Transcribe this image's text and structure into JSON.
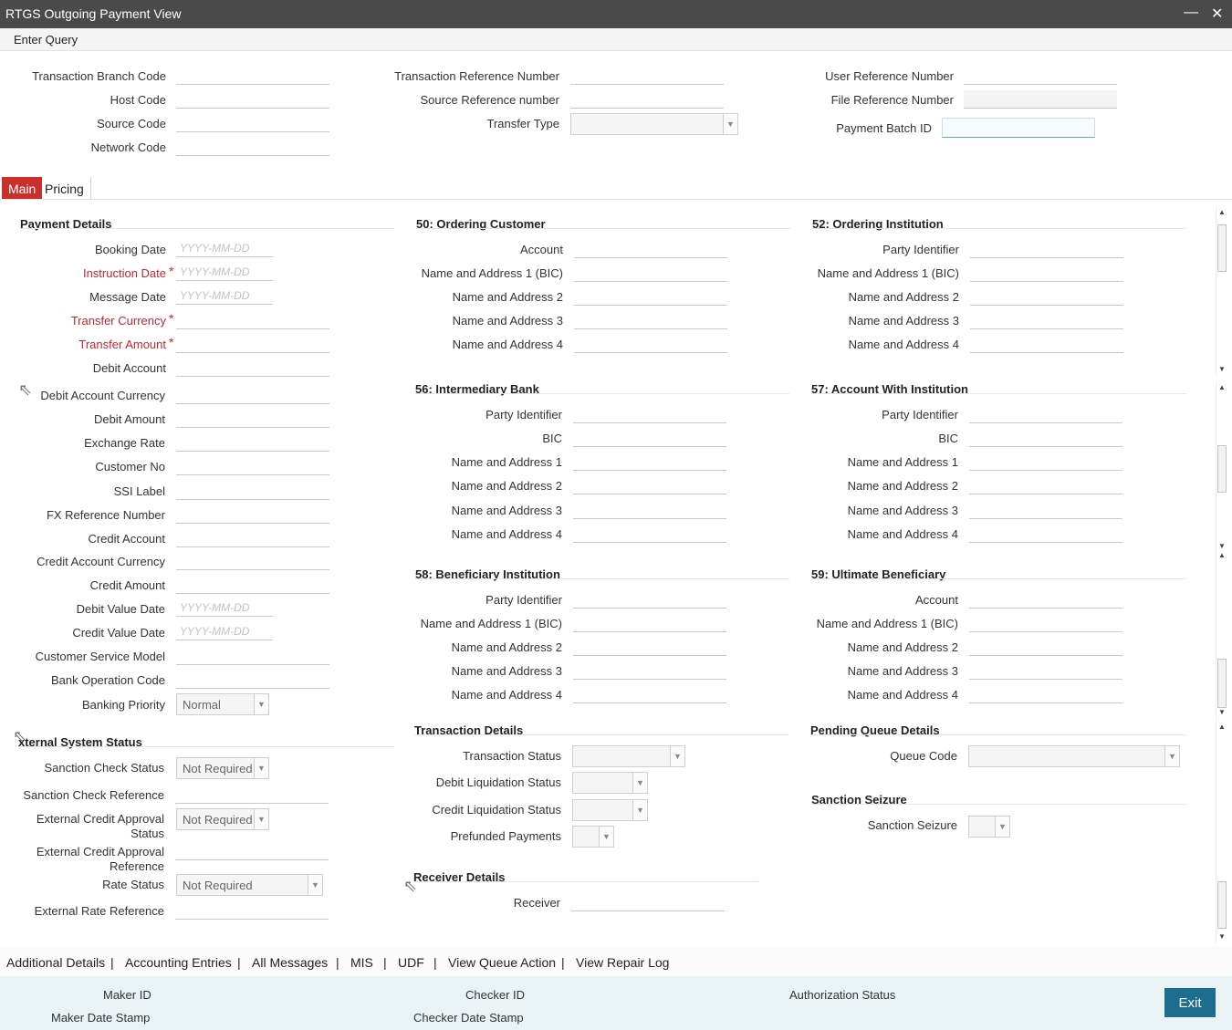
{
  "window": {
    "title": "RTGS Outgoing Payment View"
  },
  "menu": {
    "enter_query": "Enter Query"
  },
  "header": {
    "transaction_branch_code": "Transaction Branch Code",
    "host_code": "Host Code",
    "source_code": "Source Code",
    "network_code": "Network Code",
    "transaction_reference_number": "Transaction Reference Number",
    "source_reference_number": "Source Reference number",
    "transfer_type": "Transfer Type",
    "user_reference_number": "User Reference Number",
    "file_reference_number": "File Reference Number",
    "payment_batch_id": "Payment Batch ID"
  },
  "tabs": {
    "main": "Main",
    "pricing": "Pricing"
  },
  "date_placeholder": "YYYY-MM-DD",
  "payment_details": {
    "title": "Payment Details",
    "booking_date": "Booking Date",
    "instruction_date": "Instruction Date",
    "message_date": "Message Date",
    "transfer_currency": "Transfer Currency",
    "transfer_amount": "Transfer Amount",
    "debit_account": "Debit Account",
    "debit_account_currency": "Debit Account Currency",
    "debit_amount": "Debit Amount",
    "exchange_rate": "Exchange Rate",
    "customer_no": "Customer No",
    "ssi_label": "SSI Label",
    "fx_reference_number": "FX Reference Number",
    "credit_account": "Credit Account",
    "credit_account_currency": "Credit Account Currency",
    "credit_amount": "Credit Amount",
    "debit_value_date": "Debit Value Date",
    "credit_value_date": "Credit Value Date",
    "customer_service_model": "Customer Service Model",
    "bank_operation_code": "Bank Operation Code",
    "banking_priority": "Banking Priority",
    "banking_priority_value": "Normal"
  },
  "external_system_status": {
    "title": "xternal System Status",
    "sanction_check_status": "Sanction Check Status",
    "sanction_check_reference": "Sanction Check Reference",
    "external_credit_approval_status_l1": "External Credit Approval",
    "external_credit_approval_status_l2": "Status",
    "external_credit_approval_reference_l1": "External Credit Approval",
    "external_credit_approval_reference_l2": "Reference",
    "rate_status": "Rate Status",
    "external_rate_reference": "External Rate Reference",
    "not_required": "Not Required"
  },
  "ordering_customer": {
    "title": "50: Ordering Customer",
    "account": "Account",
    "name1": "Name and Address 1 (BIC)",
    "name2": "Name and Address 2",
    "name3": "Name and Address 3",
    "name4": "Name and Address 4"
  },
  "ordering_institution": {
    "title": "52: Ordering Institution",
    "party_identifier": "Party Identifier",
    "name1": "Name and Address 1 (BIC)",
    "name2": "Name and Address 2",
    "name3": "Name and Address 3",
    "name4": "Name and Address 4"
  },
  "intermediary_bank": {
    "title": "56: Intermediary Bank",
    "party_identifier": "Party Identifier",
    "bic": "BIC",
    "name1": "Name and Address 1",
    "name2": "Name and Address 2",
    "name3": "Name and Address 3",
    "name4": "Name and Address 4"
  },
  "account_with_institution": {
    "title": "57: Account With Institution",
    "party_identifier": "Party Identifier",
    "bic": "BIC",
    "name1": "Name and Address 1",
    "name2": "Name and Address 2",
    "name3": "Name and Address 3",
    "name4": "Name and Address 4"
  },
  "beneficiary_institution": {
    "title": "58: Beneficiary Institution",
    "party_identifier": "Party Identifier",
    "name1": "Name and Address 1 (BIC)",
    "name2": "Name and Address 2",
    "name3": "Name and Address 3",
    "name4": "Name and Address 4"
  },
  "ultimate_beneficiary": {
    "title": "59: Ultimate Beneficiary",
    "account": "Account",
    "name1": "Name and Address 1 (BIC)",
    "name2": "Name and Address 2",
    "name3": "Name and Address 3",
    "name4": "Name and Address 4"
  },
  "transaction_details": {
    "title": "Transaction Details",
    "transaction_status": "Transaction Status",
    "debit_liquidation_status": "Debit Liquidation Status",
    "credit_liquidation_status": "Credit Liquidation Status",
    "prefunded_payments": "Prefunded Payments"
  },
  "pending_queue": {
    "title": "Pending Queue Details",
    "queue_code": "Queue Code"
  },
  "sanction_seizure": {
    "title": "Sanction Seizure",
    "label": "Sanction Seizure"
  },
  "receiver_details": {
    "title": "Receiver Details",
    "receiver": "Receiver"
  },
  "bottom_links": {
    "additional_details": "Additional Details",
    "accounting_entries": "Accounting Entries",
    "all_messages": "All Messages",
    "mis": "MIS",
    "udf": "UDF",
    "view_queue_action": "View Queue Action",
    "view_repair_log": "View Repair Log",
    "separator": "|"
  },
  "footer": {
    "maker_id": "Maker ID",
    "maker_date_stamp": "Maker Date Stamp",
    "checker_id": "Checker ID",
    "checker_date_stamp": "Checker Date Stamp",
    "authorization_status": "Authorization Status",
    "exit": "Exit"
  },
  "icons": {
    "minimize": "—",
    "close": "✕",
    "dropdown": "▼",
    "scroll_up": "▲",
    "scroll_down": "▼",
    "cursor": "⇖"
  },
  "colors": {
    "required": "#c0282d",
    "active_tab": "#c9302c",
    "exit_button": "#1d6d8f",
    "footer_bg": "#e9f2f5",
    "titlebar": "#4a4a4a"
  }
}
